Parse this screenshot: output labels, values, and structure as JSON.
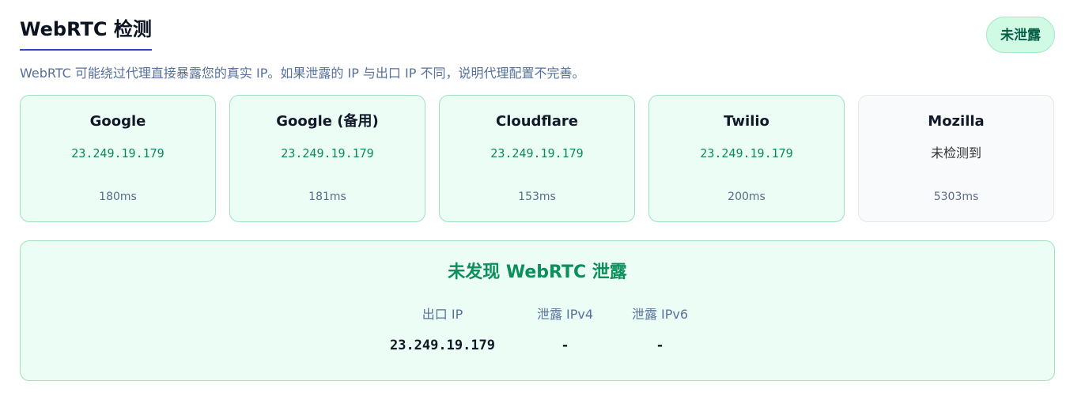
{
  "header": {
    "title": "WebRTC 检测",
    "status_badge": "未泄露"
  },
  "description": "WebRTC 可能绕过代理直接暴露您的真实 IP。如果泄露的 IP 与出口 IP 不同，说明代理配置不完善。",
  "cards": [
    {
      "name": "Google",
      "ip": "23.249.19.179",
      "latency": "180ms"
    },
    {
      "name": "Google (备用)",
      "ip": "23.249.19.179",
      "latency": "181ms"
    },
    {
      "name": "Cloudflare",
      "ip": "23.249.19.179",
      "latency": "153ms"
    },
    {
      "name": "Twilio",
      "ip": "23.249.19.179",
      "latency": "200ms"
    },
    {
      "name": "Mozilla",
      "ip": "未检测到",
      "latency": "5303ms"
    }
  ],
  "summary": {
    "title": "未发现 WebRTC 泄露",
    "columns": [
      {
        "label": "出口 IP",
        "value": "23.249.19.179"
      },
      {
        "label": "泄露 IPv4",
        "value": "-"
      },
      {
        "label": "泄露 IPv6",
        "value": "-"
      }
    ]
  },
  "colors": {
    "accent_blue": "#2f49c9",
    "success_green": "#0b8f5c",
    "success_bg": "#ecfdf5",
    "neutral_bg": "#f9fafb"
  }
}
